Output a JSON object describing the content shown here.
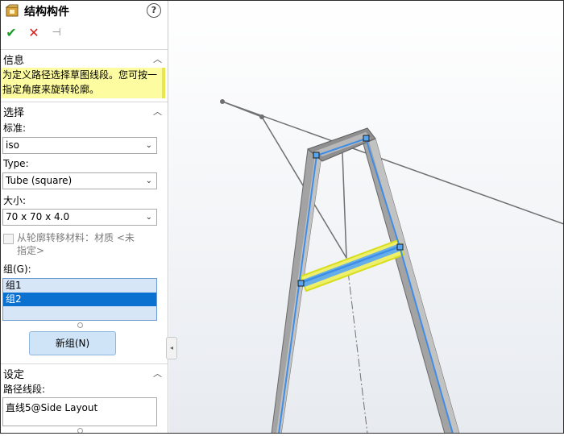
{
  "panel": {
    "title": "结构构件",
    "title_icon": "structural-member-icon",
    "help_icon": "help-icon",
    "help_symbol": "?",
    "toolbar": {
      "ok_icon": "check-icon",
      "ok_symbol": "✔",
      "cancel_icon": "close-icon",
      "cancel_symbol": "✕",
      "pin_icon": "pushpin-icon",
      "pin_symbol": "⊣"
    },
    "info": {
      "title": "信息",
      "line1": "为定义路径选择草图线段。您可按一",
      "line2": "指定角度来旋转轮廓。"
    },
    "selection": {
      "title": "选择",
      "standard_label": "标准:",
      "standard_value": "iso",
      "type_label": "Type:",
      "type_value": "Tube (square)",
      "size_label": "大小:",
      "size_value": "70 x 70 x 4.0",
      "transfer_line1": "从轮廓转移材料：材质 <未",
      "transfer_line2": "指定>",
      "transfer_checked": false,
      "groups_label": "组(G):",
      "groups": [
        "组1",
        "组2"
      ],
      "selected_group": "组2",
      "new_group_button": "新组(N)"
    },
    "settings": {
      "title": "设定",
      "path_label": "路径线段:",
      "path_value": "直线5@Side Layout"
    },
    "chevron_symbol": "︿",
    "dropdown_symbol": "⌄"
  },
  "colors": {
    "info_background": "#fdfca0",
    "selected_list_item": "#0a71d0",
    "member_highlight": "#e6ee2a",
    "path_line": "#3d8ee8",
    "member_body": "#9a9a9a"
  }
}
